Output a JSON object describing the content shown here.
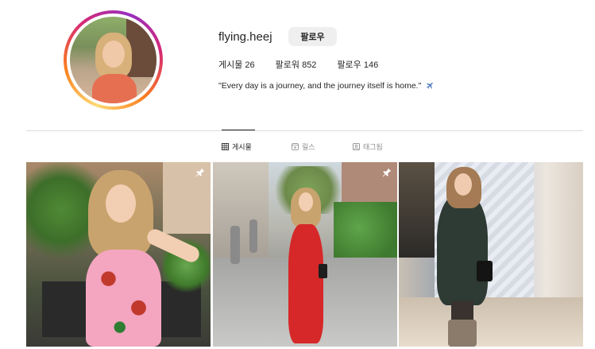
{
  "profile": {
    "username": "flying.heej",
    "follow_label": "팔로우",
    "stats": {
      "posts": "게시물 26",
      "followers": "팔로워 852",
      "following": "팔로우 146"
    },
    "bio": "\"Every day is a journey, and the journey itself is home.\"",
    "bio_emoji_icon": "airplane-icon"
  },
  "tabs": [
    {
      "label": "게시물",
      "icon": "grid-icon",
      "active": true
    },
    {
      "label": "릴스",
      "icon": "reels-icon",
      "active": false
    },
    {
      "label": "태그됨",
      "icon": "tagged-icon",
      "active": false
    }
  ],
  "posts": [
    {
      "pinned": true,
      "pin_icon": "pin-icon"
    },
    {
      "pinned": true,
      "pin_icon": "pin-icon"
    },
    {
      "pinned": false
    }
  ],
  "colors": {
    "text": "#262626",
    "muted": "#8e8e8e",
    "divider": "#dbdbdb",
    "button_bg": "#efefef"
  }
}
